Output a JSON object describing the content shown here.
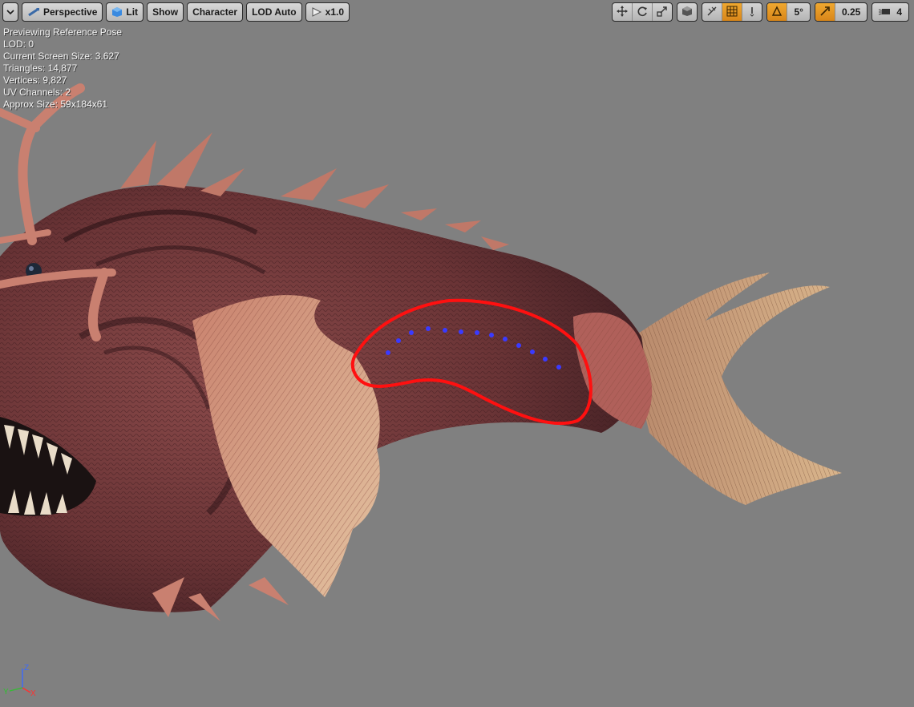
{
  "toolbar": {
    "menu_icon": "chevron-down-icon",
    "view_mode": "Perspective",
    "lighting": "Lit",
    "show": "Show",
    "character": "Character",
    "lod": "LOD Auto",
    "playback_speed": "x1.0",
    "grid_snap_angle": "5°",
    "scale_snap": "0.25",
    "camera_speed": "4"
  },
  "stats": {
    "line1": "Previewing Reference Pose",
    "line2": "LOD: 0",
    "line3": "Current Screen Size: 3.627",
    "line4": "Triangles: 14,877",
    "line5": "Vertices: 9,827",
    "line6": "UV Channels: 2",
    "line7": "Approx Size: 59x184x61"
  },
  "axis": {
    "z": "Z",
    "x": "X",
    "y": "Y"
  },
  "colors": {
    "viewport_bg": "#808080",
    "annotation": "#ff1010",
    "sockets": "#3a3aff",
    "accent": "#e89a24"
  },
  "annotation": {
    "socket_dots": 13
  }
}
